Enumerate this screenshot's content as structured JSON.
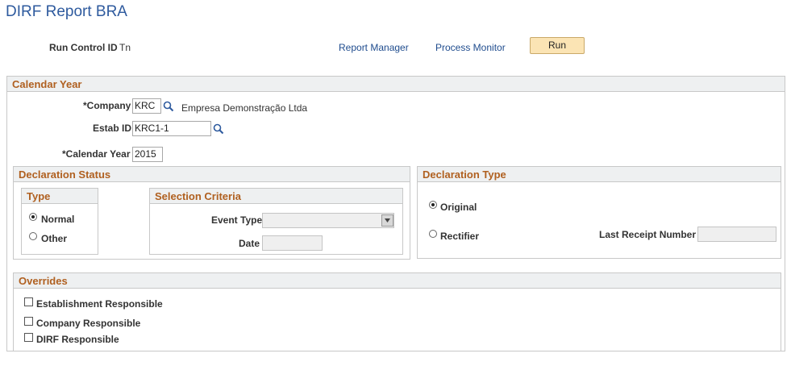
{
  "page": {
    "title": "DIRF Report BRA"
  },
  "header": {
    "run_control_label": "Run Control ID",
    "run_control_value": "Tn",
    "report_manager": "Report Manager",
    "process_monitor": "Process Monitor",
    "run": "Run"
  },
  "calendar": {
    "section_title": "Calendar Year",
    "company_label": "*Company",
    "company_value": "KRC",
    "company_desc": "Empresa Demonstração Ltda",
    "estab_label": "Estab ID",
    "estab_value": "KRC1-1",
    "year_label": "*Calendar Year",
    "year_value": "2015"
  },
  "declaration_status": {
    "title": "Declaration Status",
    "type": {
      "title": "Type",
      "normal": "Normal",
      "other": "Other",
      "selected": "Normal"
    },
    "selection": {
      "title": "Selection Criteria",
      "event_type_label": "Event Type",
      "event_type_value": "",
      "date_label": "Date",
      "date_value": ""
    }
  },
  "declaration_type": {
    "title": "Declaration Type",
    "original": "Original",
    "rectifier": "Rectifier",
    "selected": "Original",
    "last_receipt_label": "Last Receipt Number",
    "last_receipt_value": ""
  },
  "overrides": {
    "title": "Overrides",
    "establishment": "Establishment Responsible",
    "company": "Company Responsible",
    "dirf": "DIRF Responsible"
  },
  "icons": [
    "search-icon",
    "dropdown-arrow-icon",
    "radio-icon",
    "checkbox-icon"
  ]
}
